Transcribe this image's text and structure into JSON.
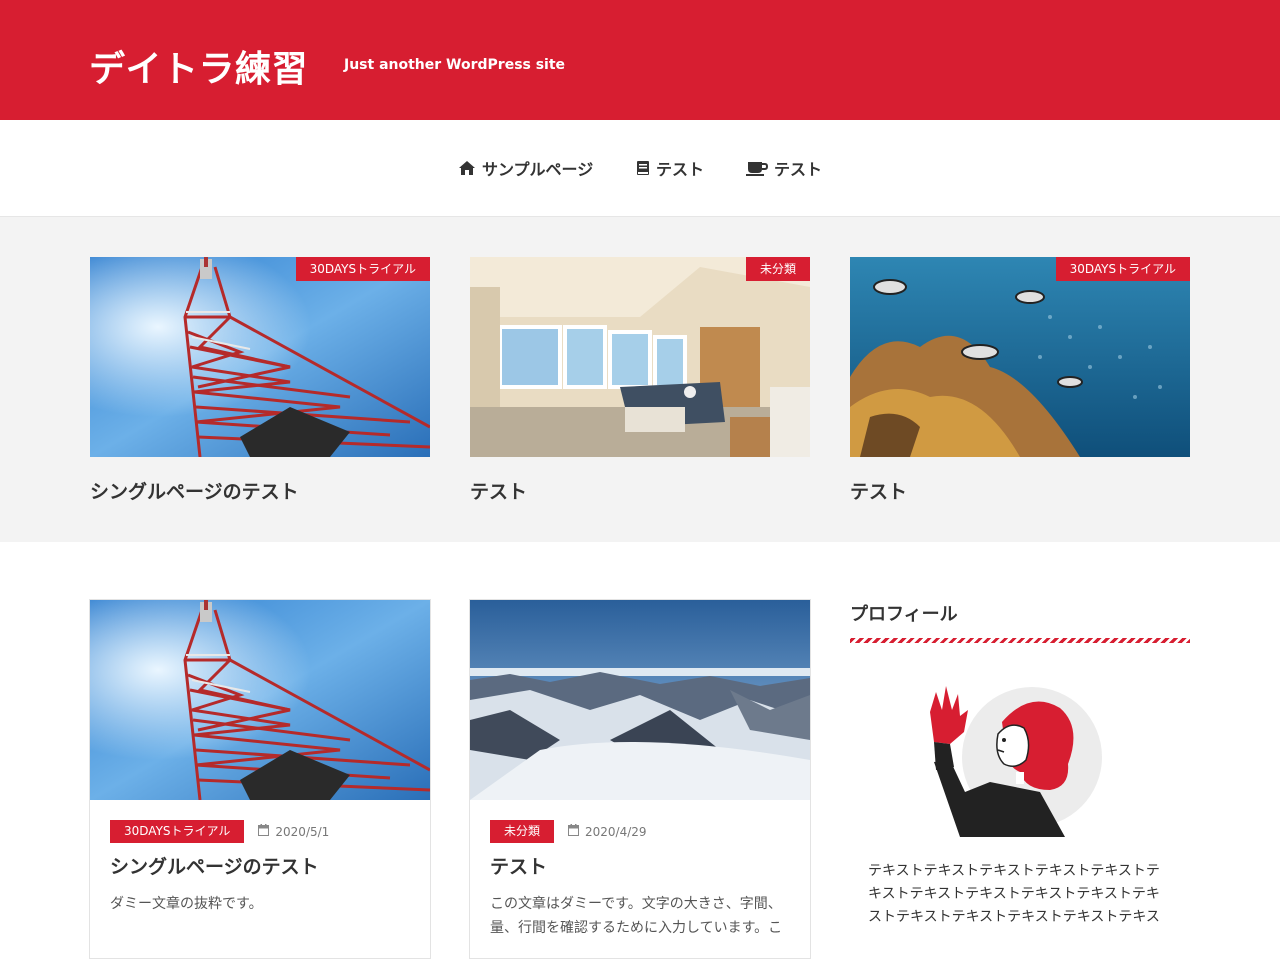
{
  "header": {
    "site_title": "デイトラ練習",
    "tagline": "Just another WordPress site",
    "brand_color": "#d71e31"
  },
  "nav": {
    "items": [
      {
        "label": "サンプルページ",
        "icon": "home-icon"
      },
      {
        "label": "テスト",
        "icon": "book-icon"
      },
      {
        "label": "テスト",
        "icon": "coffee-icon"
      }
    ]
  },
  "featured": [
    {
      "category": "30DAYSトライアル",
      "title": "シングルページのテスト",
      "image": "tokyo-tower-photo"
    },
    {
      "category": "未分類",
      "title": "テスト",
      "image": "living-room-photo"
    },
    {
      "category": "30DAYSトライアル",
      "title": "テスト",
      "image": "coral-reef-photo"
    }
  ],
  "posts": [
    {
      "category": "30DAYSトライアル",
      "date": "2020/5/1",
      "title": "シングルページのテスト",
      "excerpt": "ダミー文章の抜粋です。",
      "image": "tokyo-tower-photo"
    },
    {
      "category": "未分類",
      "date": "2020/4/29",
      "title": "テスト",
      "excerpt": "この文章はダミーです。文字の大きさ、字間、量、行間を確認するために入力しています。こ",
      "image": "snowy-mountains-photo"
    }
  ],
  "sidebar": {
    "widget_title": "プロフィール",
    "profile_text": "テキストテキストテキストテキストテキストテキストテキストテキストテキストテキストテキストテキストテキストテキストテキストテキス"
  }
}
